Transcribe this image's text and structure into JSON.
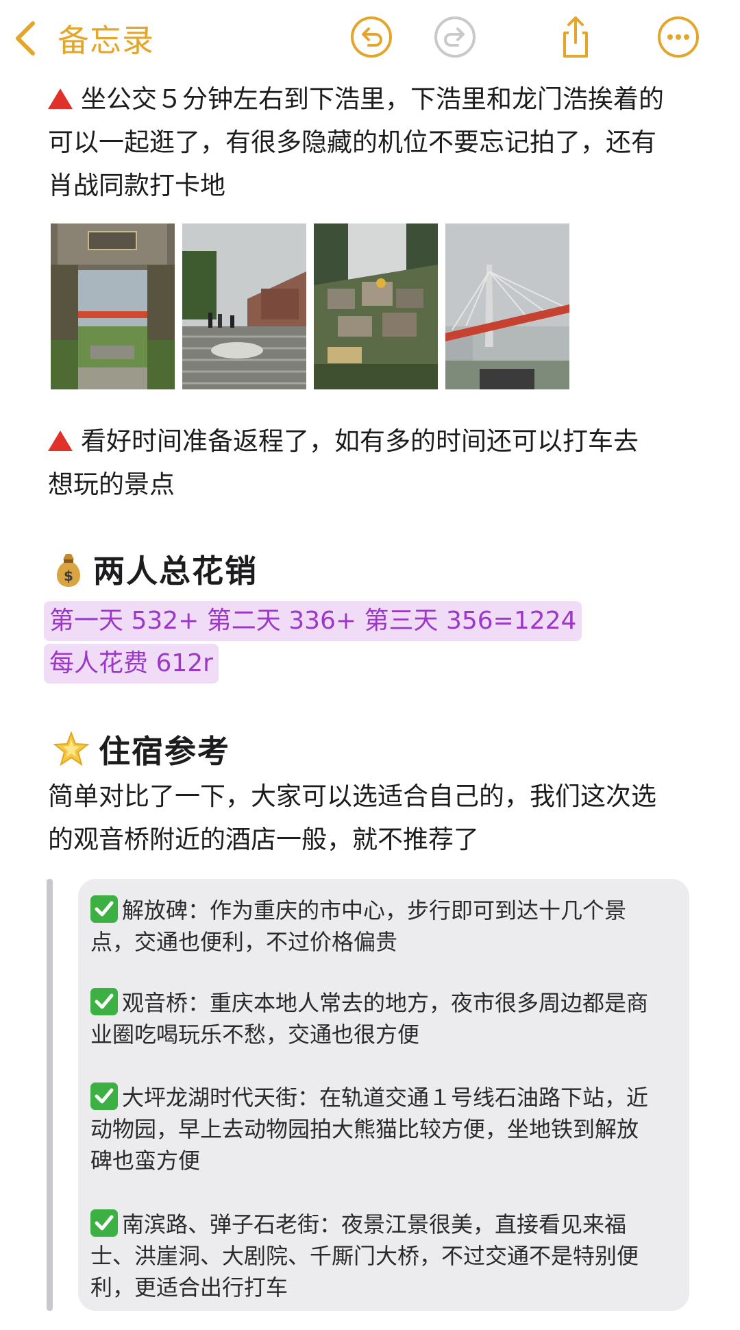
{
  "nav": {
    "back_label": "备忘录",
    "icons": [
      "chevron-left-icon",
      "undo-icon",
      "redo-icon",
      "share-icon",
      "more-icon"
    ],
    "accent_color": "#e4a62a"
  },
  "paragraphs": {
    "p1": [
      "坐公交５分钟左右到下浩里，下浩里和龙门浩挨着的",
      "可以一起逛了，有很多隐藏的机位不要忘记拍了，还有",
      "肖战同款打卡地"
    ],
    "p2": [
      "看好时间准备返程了，如有多的时间还可以打车去",
      "想玩的景点"
    ],
    "p3": [
      "简单对比了一下，大家可以选适合自己的，我们这次选",
      "的观音桥附近的酒店一般，就不推荐了"
    ]
  },
  "photos": [
    "arch-gate-photo",
    "stairs-wall-photo",
    "hillside-village-photo",
    "bridge-photo"
  ],
  "cost": {
    "heading": "两人总花销",
    "line1": "第一天 532+ 第二天 336+ 第三天 356=1224",
    "line2": "每人花费 612r",
    "highlight_color": "#f0dcf7",
    "text_color": "#9b38c7"
  },
  "stay": {
    "heading": "住宿参考",
    "items": [
      [
        "解放碑：作为重庆的市中心，步行即可到达十几个景",
        "点，交通也便利，不过价格偏贵"
      ],
      [
        "观音桥：重庆本地人常去的地方，夜市很多周边都是商",
        "业圈吃喝玩乐不愁，交通也很方便"
      ],
      [
        "大坪龙湖时代天街：在轨道交通１号线石油路下站，近",
        "动物园，早上去动物园拍大熊猫比较方便，坐地铁到解放",
        "碑也蛮方便"
      ],
      [
        "南滨路、弹子石老街：夜景江景很美，直接看见来福",
        "士、洪崖洞、大剧院、千厮门大桥，不过交通不是特别便",
        "利，更适合出行打车"
      ]
    ]
  }
}
